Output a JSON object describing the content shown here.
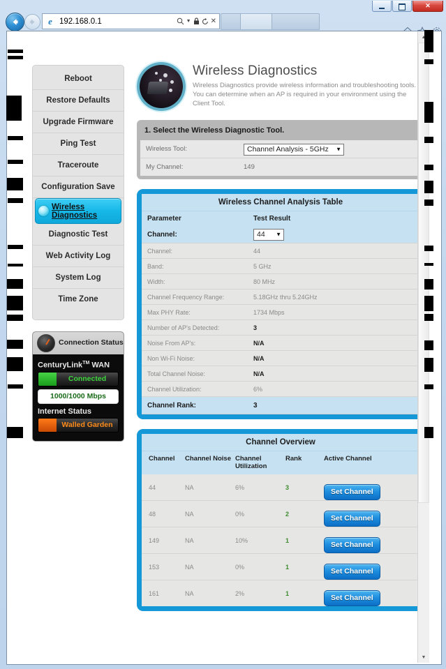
{
  "browser": {
    "url": "192.168.0.1",
    "favicon": "internet-explorer-icon",
    "back_icon": "back-arrow-icon",
    "forward_icon": "forward-arrow-icon",
    "search_icon": "search-icon",
    "lock_icon": "lock-icon",
    "refresh_icon": "refresh-icon",
    "stop_icon": "stop-icon",
    "home_icon": "home-icon",
    "favorites_icon": "star-icon",
    "tools_icon": "gear-icon",
    "minimize_label": "",
    "maximize_label": "",
    "close_label": "✕"
  },
  "sidebar": {
    "items": [
      {
        "label": "Reboot",
        "selected": false
      },
      {
        "label": "Restore Defaults",
        "selected": false
      },
      {
        "label": "Upgrade Firmware",
        "selected": false
      },
      {
        "label": "Ping Test",
        "selected": false
      },
      {
        "label": "Traceroute",
        "selected": false
      },
      {
        "label": "Configuration Save",
        "selected": false
      },
      {
        "label": "Wireless Diagnostics",
        "selected": true
      },
      {
        "label": "Diagnostic Test",
        "selected": false
      },
      {
        "label": "Web Activity Log",
        "selected": false
      },
      {
        "label": "System Log",
        "selected": false
      },
      {
        "label": "Time Zone",
        "selected": false
      }
    ],
    "status": {
      "title": "Connection Status",
      "wan_label": "CenturyLink",
      "wan_tm": "TM",
      "wan_suffix": "WAN",
      "wan_state": "Connected",
      "speed": "1000/1000 Mbps",
      "internet_label": "Internet Status",
      "internet_state": "Walled Garden"
    }
  },
  "header": {
    "title": "Wireless Diagnostics",
    "description": "Wireless Diagnostics provide wireless information and troubleshooting tools. You can determine when an AP is required in your environment using the Client Tool."
  },
  "step1": {
    "title": "1.  Select the Wireless Diagnostic Tool.",
    "tool_label": "Wireless Tool:",
    "tool_value": "Channel Analysis - 5GHz",
    "tool_options": [
      "Channel Analysis - 5GHz"
    ],
    "my_channel_label": "My Channel:",
    "my_channel_value": "149"
  },
  "analysis": {
    "title": "Wireless Channel Analysis Table",
    "col_parameter": "Parameter",
    "col_result": "Test Result",
    "channel_select_label": "Channel:",
    "channel_select_value": "44",
    "channel_select_options": [
      "44"
    ],
    "rows": [
      {
        "key": "Channel:",
        "value": "44"
      },
      {
        "key": "Band:",
        "value": "5 GHz"
      },
      {
        "key": "Width:",
        "value": "80 MHz"
      },
      {
        "key": "Channel Frequency Range:",
        "value": "5.18GHz thru 5.24GHz"
      },
      {
        "key": "Max PHY Rate:",
        "value": "1734 Mbps"
      },
      {
        "key": "Number of AP's Detected:",
        "value": "3",
        "strong": true
      },
      {
        "key": "Noise From AP's:",
        "value": "N/A",
        "strong": true
      },
      {
        "key": "Non Wi-Fi Noise:",
        "value": "N/A",
        "strong": true
      },
      {
        "key": "Total Channel Noise:",
        "value": "N/A",
        "strong": true
      },
      {
        "key": "Channel Utilization:",
        "value": "6%"
      }
    ],
    "rank_label": "Channel Rank:",
    "rank_value": "3"
  },
  "overview": {
    "title": "Channel Overview",
    "columns": [
      "Channel",
      "Channel Noise",
      "Channel Utilization",
      "Rank",
      "Active Channel"
    ],
    "button_label": "Set Channel",
    "rows": [
      {
        "channel": "44",
        "noise": "NA",
        "utilization": "6%",
        "rank": "3"
      },
      {
        "channel": "48",
        "noise": "NA",
        "utilization": "0%",
        "rank": "2"
      },
      {
        "channel": "149",
        "noise": "NA",
        "utilization": "10%",
        "rank": "1"
      },
      {
        "channel": "153",
        "noise": "NA",
        "utilization": "0%",
        "rank": "1"
      },
      {
        "channel": "161",
        "noise": "NA",
        "utilization": "2%",
        "rank": "1"
      }
    ]
  },
  "colors": {
    "accent_blue": "#1598d8",
    "panel_light_blue": "#c6e2f2",
    "status_green": "#3fd63f",
    "status_orange": "#ff8c1a",
    "rank_green": "#3d8a2e"
  }
}
